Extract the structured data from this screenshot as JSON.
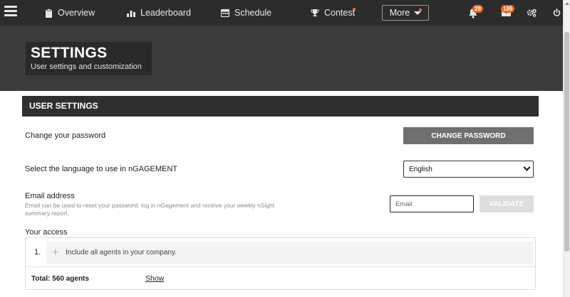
{
  "nav": {
    "items": [
      {
        "label": "Overview",
        "icon": "clipboard-icon"
      },
      {
        "label": "Leaderboard",
        "icon": "bar-chart-icon"
      },
      {
        "label": "Schedule",
        "icon": "calendar-icon"
      },
      {
        "label": "Contest",
        "icon": "trophy-icon"
      }
    ],
    "more_label": "More",
    "notifications_count": "29",
    "messages_count": "185",
    "accent_color": "#f0661e"
  },
  "header": {
    "title": "SETTINGS",
    "subtitle": "User settings and customization"
  },
  "section": {
    "title": "USER SETTINGS"
  },
  "password": {
    "label": "Change your password",
    "button_label": "CHANGE PASSWORD"
  },
  "language": {
    "label": "Select the language to use in nGAGEMENT",
    "selected": "English"
  },
  "email": {
    "label": "Email address",
    "help": "Email can be used to reset your password, log in nGagement and receive your weekly nSight summary report.",
    "placeholder": "Email",
    "validate_label": "VALIDATE"
  },
  "access": {
    "label": "Your access",
    "rows": [
      {
        "number": "1.",
        "text": "Include all agents in your company."
      }
    ],
    "total": "Total: 560 agents",
    "show_label": "Show"
  }
}
